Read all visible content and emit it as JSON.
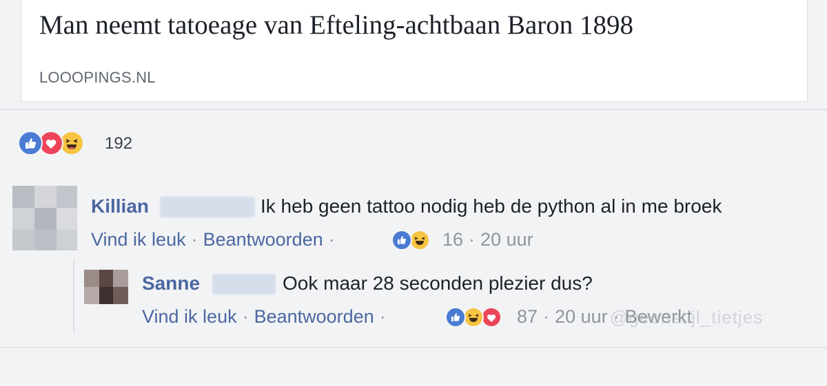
{
  "link_preview": {
    "title": "Man neemt tatoeage van Efteling-achtbaan Baron 1898",
    "domain": "LOOOPINGS.NL"
  },
  "reactions_summary": {
    "icons": [
      "like-icon",
      "love-icon",
      "haha-icon"
    ],
    "count": "192"
  },
  "comments": [
    {
      "name": "Killian",
      "text": "Ik heb geen tattoo nodig heb de python al in me broek",
      "like_label": "Vind ik leuk",
      "reply_label": "Beantwoorden",
      "reaction_icons": [
        "like-icon",
        "haha-icon"
      ],
      "reaction_count": "16",
      "time": "20 uur",
      "separator": "·"
    }
  ],
  "replies": [
    {
      "name": "Sanne",
      "text": "Ook maar 28 seconden plezier dus?",
      "like_label": "Vind ik leuk",
      "reply_label": "Beantwoorden",
      "reaction_icons": [
        "like-icon",
        "haha-icon",
        "love-icon"
      ],
      "reaction_count": "87",
      "time": "20 uur",
      "edited_label": "Bewerkt",
      "separator": "·"
    }
  ],
  "watermark": "@geenstijl_tietjes",
  "colors": {
    "link": "#4b67a1",
    "like": "#4a7bd3",
    "love": "#ec4559",
    "haha": "#f7c443",
    "background": "#f2f3f5"
  }
}
